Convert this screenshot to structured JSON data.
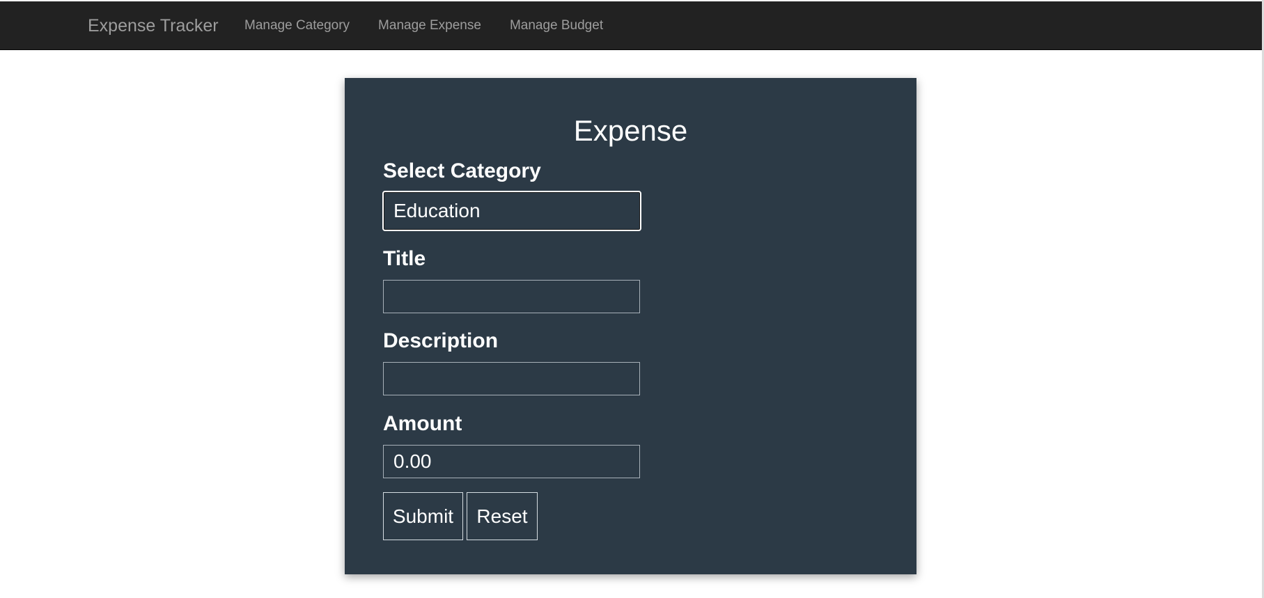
{
  "navbar": {
    "brand": "Expense Tracker",
    "items": [
      {
        "label": "Manage Category"
      },
      {
        "label": "Manage Expense"
      },
      {
        "label": "Manage Budget"
      }
    ]
  },
  "form": {
    "title": "Expense",
    "category": {
      "label": "Select Category",
      "selected": "Education"
    },
    "title_field": {
      "label": "Title",
      "value": ""
    },
    "description_field": {
      "label": "Description",
      "value": ""
    },
    "amount_field": {
      "label": "Amount",
      "value": "0.00"
    },
    "buttons": {
      "submit": "Submit",
      "reset": "Reset"
    }
  },
  "colors": {
    "navbar_bg": "#222222",
    "nav_text": "#9d9d9d",
    "card_bg": "#2c3a46",
    "text": "#ffffff"
  }
}
